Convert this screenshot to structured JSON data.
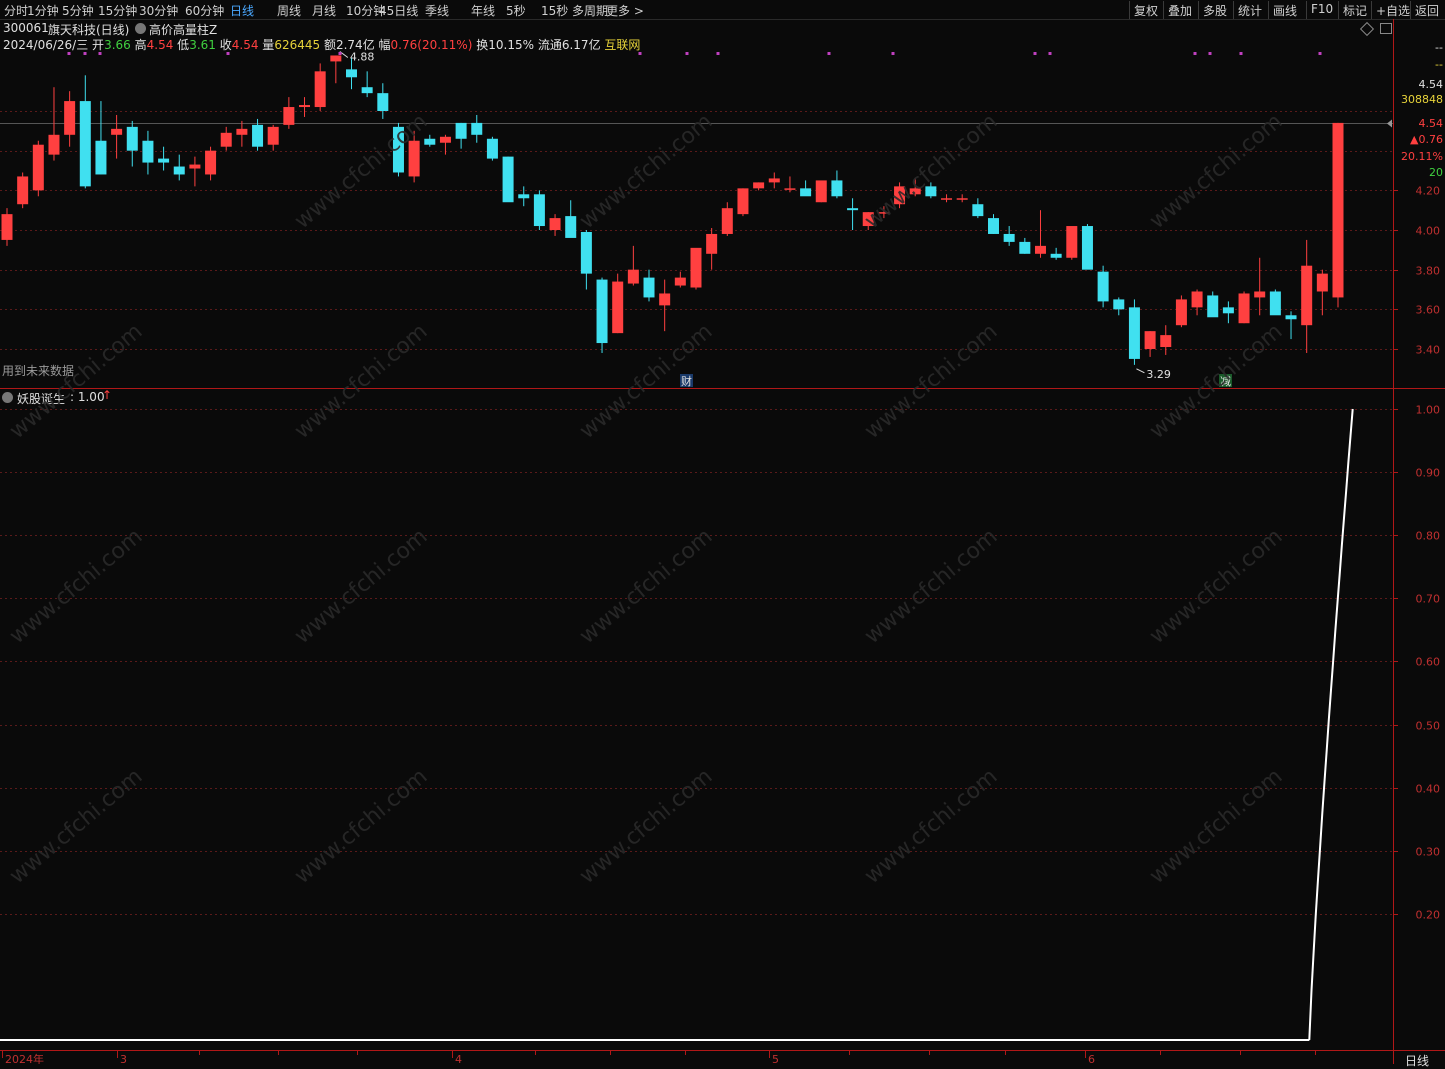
{
  "toolbar": {
    "periods": [
      "分时",
      "1分钟",
      "5分钟",
      "15分钟",
      "30分钟",
      "60分钟",
      "日线",
      "周线",
      "月线",
      "10分钟",
      "45日线",
      "季线",
      "年线",
      "5秒",
      "15秒",
      "多周期",
      "更多 >"
    ],
    "active_period": "日线",
    "right_items": [
      "复权",
      "叠加",
      "多股",
      "统计",
      "画线",
      "F10",
      "标记",
      "+自选",
      "返回"
    ]
  },
  "header": {
    "code": "300061",
    "name": "旗天科技(日线)",
    "indicator": "高价高量柱Z",
    "date": "2024/06/26/三",
    "open_label": "开",
    "open": "3.66",
    "high_label": "高",
    "high": "4.54",
    "low_label": "低",
    "low": "3.61",
    "close_label": "收",
    "close": "4.54",
    "vol_label": "量",
    "vol": "626445",
    "amount_label": "额",
    "amount": "2.74亿",
    "change_label": "幅",
    "change": "0.76(20.11%)",
    "turnover_label": "换",
    "turnover": "10.15%",
    "float_label": "流通",
    "float": "6.17亿",
    "sector": "互联网"
  },
  "main_chart": {
    "ylabels": [
      "4.20",
      "4.00",
      "3.80",
      "3.60",
      "3.40"
    ],
    "ylim": [
      3.22,
      4.95
    ],
    "right_panel": [
      "--",
      "--",
      "4.54",
      "308848",
      "4.54",
      "▲0.76",
      "20.11%",
      "20"
    ],
    "high_marker": "4.88",
    "low_marker": "3.29",
    "bottom_note": "用到未来数据",
    "event_caifu": "财",
    "event_jian": "减"
  },
  "sub_chart": {
    "title": "妖股诞生",
    "value": ": 1.00",
    "ylabels": [
      "1.00",
      "0.90",
      "0.80",
      "0.70",
      "0.60",
      "0.50",
      "0.40",
      "0.30",
      "0.20"
    ],
    "ylim": [
      -0.05,
      1.03
    ]
  },
  "x_axis": {
    "labels": [
      "2024年",
      "3",
      "4",
      "5",
      "6"
    ],
    "period_label": "日线"
  },
  "watermark": "www.cfchi.com",
  "colors": {
    "up": "#ff4040",
    "down": "#40e0f0",
    "bg": "#0a0a0a",
    "grid": "#5a1a1a",
    "axis": "#b01818",
    "active": "#4aa8ff"
  },
  "chart_data": [
    {
      "type": "candlestick",
      "title": "300061 旗天科技(日线)",
      "ylabel": "",
      "ylim": [
        3.22,
        4.95
      ],
      "ohlc": [
        [
          3.95,
          4.11,
          3.92,
          4.08
        ],
        [
          4.13,
          4.29,
          4.11,
          4.27
        ],
        [
          4.2,
          4.45,
          4.17,
          4.43
        ],
        [
          4.38,
          4.72,
          4.35,
          4.48
        ],
        [
          4.48,
          4.7,
          4.42,
          4.65
        ],
        [
          4.65,
          4.78,
          4.21,
          4.22
        ],
        [
          4.45,
          4.65,
          4.28,
          4.28
        ],
        [
          4.48,
          4.58,
          4.36,
          4.51
        ],
        [
          4.52,
          4.55,
          4.32,
          4.4
        ],
        [
          4.45,
          4.5,
          4.28,
          4.34
        ],
        [
          4.36,
          4.42,
          4.3,
          4.34
        ],
        [
          4.32,
          4.38,
          4.25,
          4.28
        ],
        [
          4.31,
          4.37,
          4.22,
          4.33
        ],
        [
          4.28,
          4.42,
          4.25,
          4.4
        ],
        [
          4.42,
          4.52,
          4.4,
          4.49
        ],
        [
          4.48,
          4.55,
          4.42,
          4.51
        ],
        [
          4.53,
          4.56,
          4.4,
          4.42
        ],
        [
          4.43,
          4.53,
          4.4,
          4.52
        ],
        [
          4.53,
          4.67,
          4.51,
          4.62
        ],
        [
          4.62,
          4.67,
          4.57,
          4.63
        ],
        [
          4.62,
          4.84,
          4.6,
          4.8
        ],
        [
          4.85,
          4.88,
          4.74,
          4.88
        ],
        [
          4.81,
          4.87,
          4.71,
          4.77
        ],
        [
          4.72,
          4.8,
          4.67,
          4.69
        ],
        [
          4.69,
          4.74,
          4.56,
          4.6
        ],
        [
          4.52,
          4.54,
          4.27,
          4.29
        ],
        [
          4.27,
          4.5,
          4.24,
          4.45
        ],
        [
          4.46,
          4.48,
          4.42,
          4.43
        ],
        [
          4.44,
          4.48,
          4.38,
          4.47
        ],
        [
          4.54,
          4.54,
          4.41,
          4.46
        ],
        [
          4.54,
          4.58,
          4.44,
          4.48
        ],
        [
          4.46,
          4.47,
          4.35,
          4.36
        ],
        [
          4.37,
          4.37,
          4.15,
          4.14
        ],
        [
          4.18,
          4.22,
          4.12,
          4.16
        ],
        [
          4.18,
          4.2,
          4.0,
          4.02
        ],
        [
          4.0,
          4.08,
          3.97,
          4.06
        ],
        [
          4.07,
          4.15,
          4.01,
          3.96
        ],
        [
          3.99,
          4.0,
          3.7,
          3.78
        ],
        [
          3.75,
          3.76,
          3.38,
          3.43
        ],
        [
          3.48,
          3.78,
          3.48,
          3.74
        ],
        [
          3.73,
          3.92,
          3.72,
          3.8
        ],
        [
          3.76,
          3.8,
          3.64,
          3.66
        ],
        [
          3.62,
          3.75,
          3.49,
          3.68
        ],
        [
          3.72,
          3.79,
          3.71,
          3.76
        ],
        [
          3.71,
          3.81,
          3.7,
          3.91
        ],
        [
          3.88,
          4.01,
          3.8,
          3.98
        ],
        [
          3.98,
          4.14,
          3.97,
          4.11
        ],
        [
          4.08,
          4.21,
          4.07,
          4.21
        ],
        [
          4.21,
          4.24,
          4.2,
          4.24
        ],
        [
          4.24,
          4.29,
          4.21,
          4.26
        ],
        [
          4.21,
          4.27,
          4.19,
          4.21
        ],
        [
          4.21,
          4.25,
          4.19,
          4.17
        ],
        [
          4.14,
          4.24,
          4.14,
          4.25
        ],
        [
          4.25,
          4.3,
          4.16,
          4.17
        ],
        [
          4.11,
          4.16,
          4.0,
          4.1
        ],
        [
          4.02,
          4.09,
          4.0,
          4.09
        ],
        [
          4.09,
          4.12,
          4.06,
          4.09
        ],
        [
          4.13,
          4.24,
          4.11,
          4.22
        ],
        [
          4.18,
          4.26,
          4.17,
          4.21
        ],
        [
          4.22,
          4.24,
          4.16,
          4.17
        ],
        [
          4.16,
          4.18,
          4.14,
          4.16
        ],
        [
          4.16,
          4.18,
          4.14,
          4.16
        ],
        [
          4.13,
          4.16,
          4.06,
          4.07
        ],
        [
          4.06,
          4.08,
          3.98,
          3.98
        ],
        [
          3.98,
          4.02,
          3.92,
          3.94
        ],
        [
          3.94,
          3.96,
          3.88,
          3.88
        ],
        [
          3.88,
          4.1,
          3.86,
          3.92
        ],
        [
          3.88,
          3.91,
          3.85,
          3.86
        ],
        [
          3.86,
          3.98,
          3.85,
          4.02
        ],
        [
          4.02,
          4.03,
          3.83,
          3.8
        ],
        [
          3.79,
          3.82,
          3.61,
          3.64
        ],
        [
          3.65,
          3.66,
          3.57,
          3.6
        ],
        [
          3.61,
          3.65,
          3.32,
          3.35
        ],
        [
          3.4,
          3.49,
          3.36,
          3.49
        ],
        [
          3.41,
          3.52,
          3.37,
          3.47
        ],
        [
          3.52,
          3.67,
          3.51,
          3.65
        ],
        [
          3.61,
          3.7,
          3.57,
          3.69
        ],
        [
          3.67,
          3.69,
          3.59,
          3.56
        ],
        [
          3.61,
          3.64,
          3.53,
          3.58
        ],
        [
          3.53,
          3.69,
          3.53,
          3.68
        ],
        [
          3.66,
          3.86,
          3.57,
          3.69
        ],
        [
          3.69,
          3.7,
          3.58,
          3.57
        ],
        [
          3.57,
          3.59,
          3.45,
          3.55
        ],
        [
          3.52,
          3.95,
          3.38,
          3.82
        ],
        [
          3.69,
          3.8,
          3.57,
          3.78
        ],
        [
          3.66,
          4.54,
          3.61,
          4.54
        ]
      ]
    },
    {
      "type": "line",
      "title": "妖股诞生",
      "ylim": [
        0,
        1
      ],
      "x": [
        0,
        84,
        85,
        86
      ],
      "values": [
        0,
        0,
        1,
        1
      ]
    }
  ]
}
